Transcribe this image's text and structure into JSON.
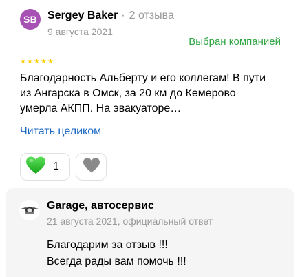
{
  "review": {
    "avatar_initials": "SB",
    "avatar_color": "#a651b3",
    "author_name": "Sergey Baker",
    "separator": "·",
    "author_reviews": "2 отзыва",
    "date": "9 августа 2021",
    "badge": "Выбран компанией",
    "badge_color": "#2fa642",
    "rating": 5,
    "rating_max": 5,
    "text": "Благодарность Альберту и его коллегам! В пути из Ангарска в Омск, за 20 км до Кемерово умерла АКПП. На эвакуаторе…",
    "read_more": "Читать целиком",
    "read_more_color": "#1a66c2",
    "like_icon": "heart-icon",
    "like_count": "1",
    "dislike_icon": "heart-outline-icon"
  },
  "reply": {
    "logo_icon": "garage-logo-icon",
    "company": "Garage, автосервис",
    "meta": "21 августа 2021, официальный ответ",
    "lines": [
      "Благодарим за отзыв !!!",
      "Всегда рады вам помочь !!!"
    ]
  }
}
